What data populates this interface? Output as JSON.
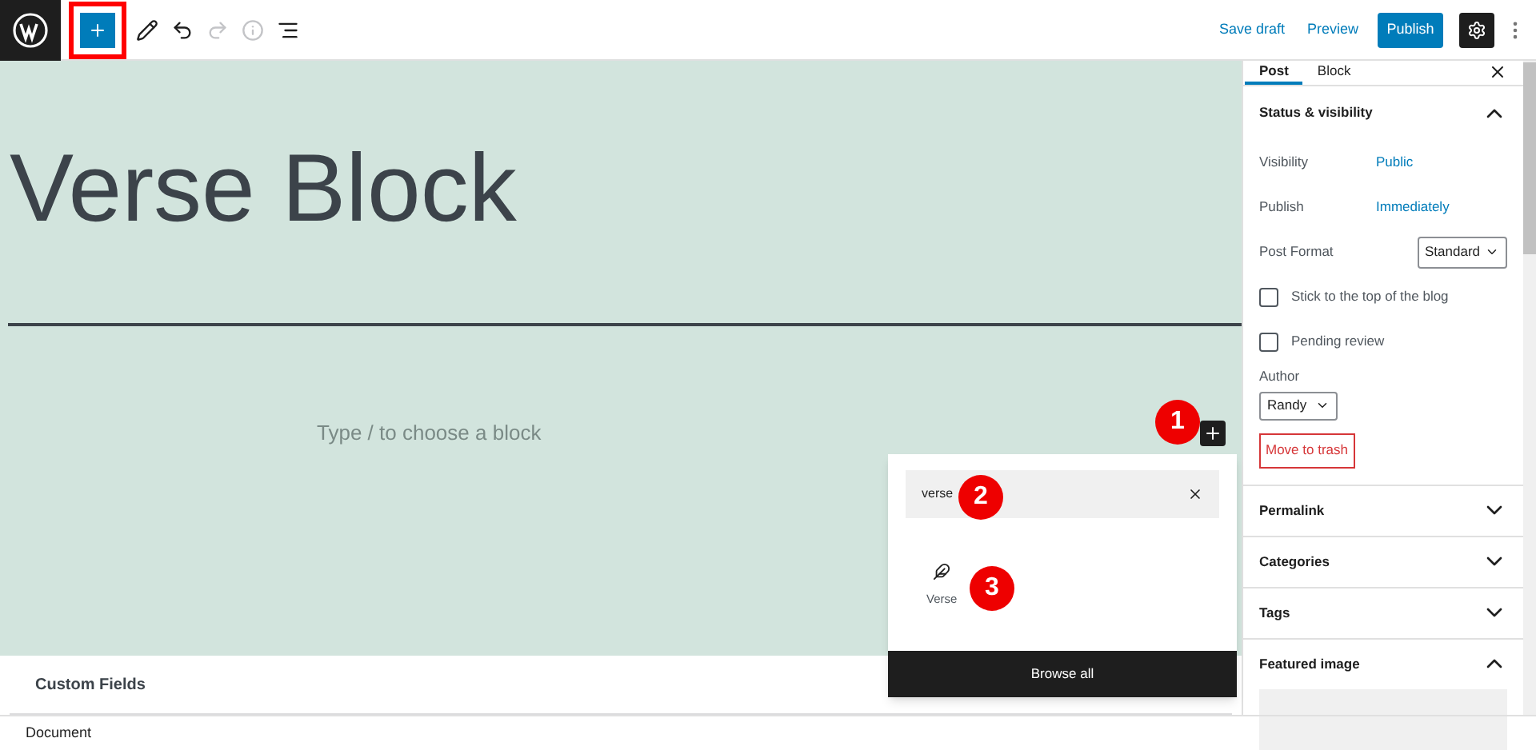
{
  "toolbar": {
    "inserter": {
      "highlighted": true
    },
    "tools": [
      {
        "kind": "pencil",
        "disabled": false
      },
      {
        "kind": "undo",
        "disabled": false
      },
      {
        "kind": "redo",
        "disabled": true
      },
      {
        "kind": "info",
        "disabled": true
      },
      {
        "kind": "list",
        "disabled": false
      }
    ],
    "save_draft": "Save draft",
    "preview": "Preview",
    "publish": "Publish"
  },
  "editor": {
    "title": "Verse Block",
    "placeholder": "Type / to choose a block"
  },
  "inserter_popup": {
    "search_value": "verse",
    "results": [
      {
        "label": "Verse"
      }
    ],
    "browse_all": "Browse all"
  },
  "callouts": [
    "1",
    "2",
    "3"
  ],
  "meta_box": {
    "title": "Custom Fields"
  },
  "status_bar": "Document",
  "sidebar": {
    "tabs": [
      {
        "label": "Post",
        "selected": true
      },
      {
        "label": "Block",
        "selected": false
      }
    ],
    "status_panel": {
      "title": "Status & visibility",
      "expanded": true,
      "rows": [
        {
          "label": "Visibility",
          "value": "Public"
        },
        {
          "label": "Publish",
          "value": "Immediately"
        }
      ],
      "post_format": {
        "label": "Post Format",
        "value": "Standard"
      },
      "checkboxes": [
        {
          "label": "Stick to the top of the blog",
          "checked": false
        },
        {
          "label": "Pending review",
          "checked": false
        }
      ],
      "author": {
        "label": "Author",
        "value": "Randy"
      },
      "trash": "Move to trash"
    },
    "panels": [
      {
        "title": "Permalink",
        "expanded": false
      },
      {
        "title": "Categories",
        "expanded": false
      },
      {
        "title": "Tags",
        "expanded": false
      },
      {
        "title": "Featured image",
        "expanded": true
      }
    ]
  }
}
